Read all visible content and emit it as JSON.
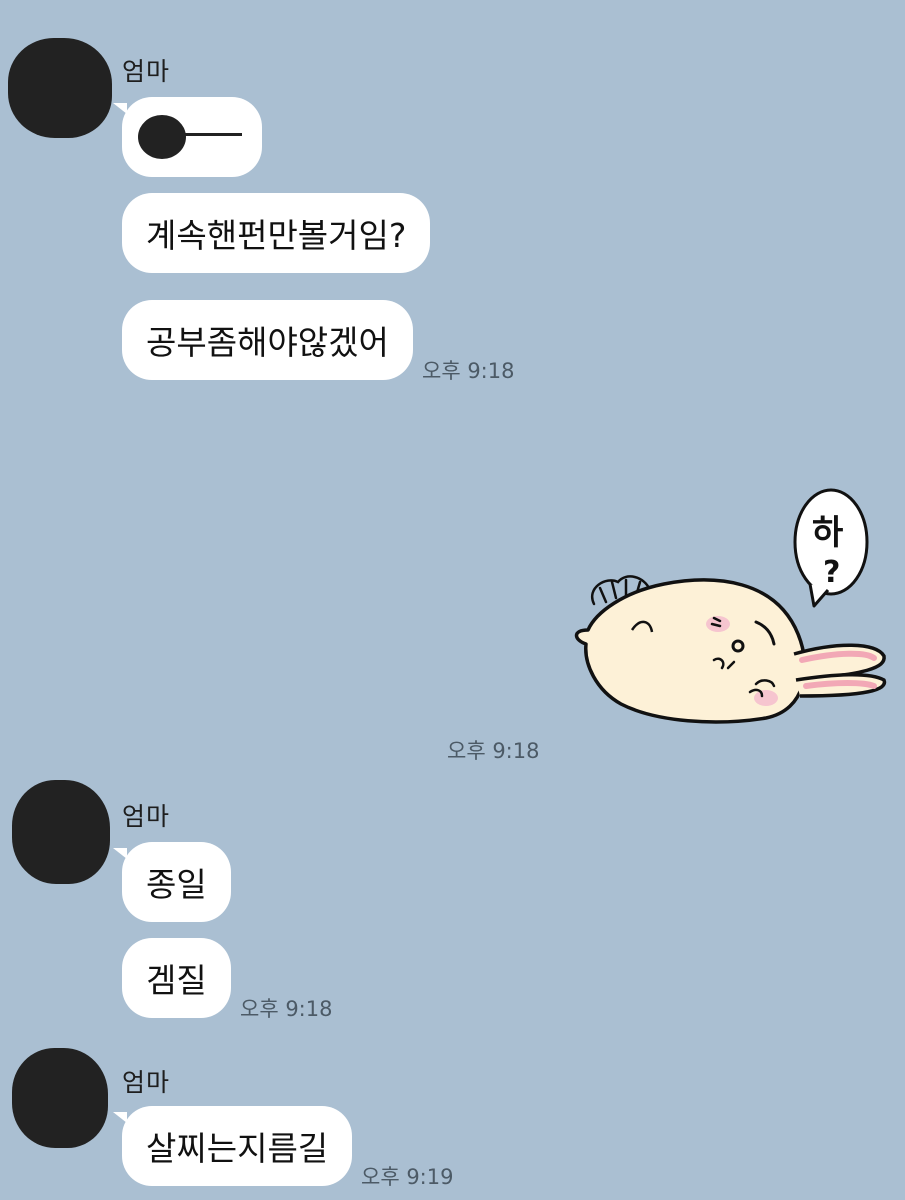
{
  "messages": [
    {
      "sender": "엄마",
      "bubbles": [
        "——",
        "계속핸펀만볼거임?",
        "공부좀해야않겠어"
      ],
      "time": "오후 9:18"
    },
    {
      "sticker": {
        "name": "rabbit-sticker",
        "speech_text": "하",
        "question_mark": "?"
      },
      "time": "오후 9:18"
    },
    {
      "sender": "엄마",
      "bubbles": [
        "종일",
        "겜질"
      ],
      "time": "오후 9:18"
    },
    {
      "sender": "엄마",
      "bubbles": [
        "살찌는지름길"
      ],
      "time": "오후 9:19"
    }
  ],
  "colors": {
    "background": "#aabfd2",
    "bubble": "#ffffff",
    "avatar_redacted": "#222222",
    "timestamp": "#4c5a66"
  }
}
